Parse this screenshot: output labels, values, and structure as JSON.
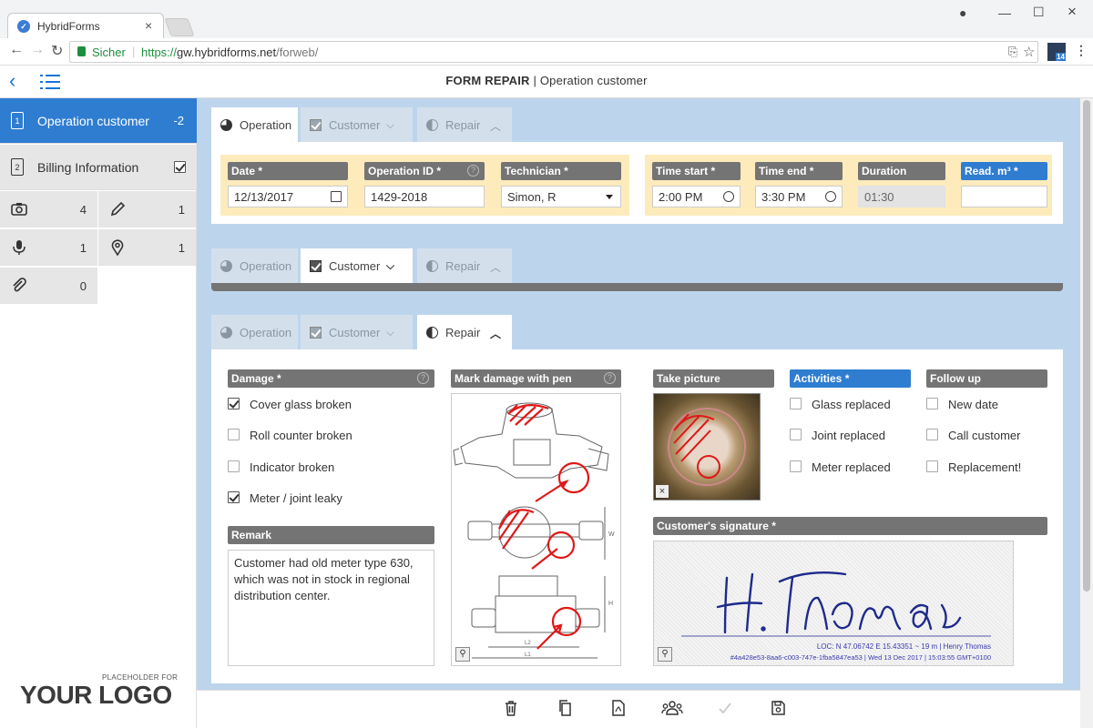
{
  "browser": {
    "tab_title": "HybridForms",
    "secure_label": "Sicher",
    "url_scheme": "https://",
    "url_host": "gw.hybridforms.net",
    "url_path": "/forweb/",
    "ext_badge": "14"
  },
  "header": {
    "title_main": "FORM REPAIR",
    "title_sep": " | ",
    "title_sub": "Operation customer"
  },
  "sidebar": {
    "items": [
      {
        "num": "1",
        "label": "Operation customer",
        "count": "-2"
      },
      {
        "num": "2",
        "label": "Billing Information"
      }
    ],
    "tiles": [
      {
        "icon": "camera-icon",
        "count": "4"
      },
      {
        "icon": "pen-icon",
        "count": "1"
      },
      {
        "icon": "microphone-icon",
        "count": "1"
      },
      {
        "icon": "location-pin-icon",
        "count": "1"
      },
      {
        "icon": "paperclip-icon",
        "count": "0"
      }
    ],
    "logo_placeholder": "PLACEHOLDER FOR",
    "logo_text": "YOUR LOGO"
  },
  "tabs": {
    "operation": "Operation",
    "customer": "Customer",
    "repair": "Repair"
  },
  "operation": {
    "date_label": "Date *",
    "date_value": "12/13/2017",
    "opid_label": "Operation ID *",
    "opid_value": "1429-2018",
    "tech_label": "Technician *",
    "tech_value": "Simon, R",
    "tstart_label": "Time start *",
    "tstart_value": "2:00 PM",
    "tend_label": "Time end *",
    "tend_value": "3:30 PM",
    "duration_label": "Duration",
    "duration_value": "01:30",
    "read_label": "Read. m³ *",
    "read_value": ""
  },
  "repair": {
    "damage_label": "Damage *",
    "damage_options": [
      {
        "label": "Cover glass broken",
        "checked": true
      },
      {
        "label": "Roll counter broken",
        "checked": false
      },
      {
        "label": "Indicator broken",
        "checked": false
      },
      {
        "label": "Meter / joint leaky",
        "checked": true
      }
    ],
    "remark_label": "Remark",
    "remark_text": "Customer had old meter type 630, which was not in stock in regional distribution center.",
    "mark_label": "Mark damage with pen",
    "picture_label": "Take picture",
    "activities_label": "Activities *",
    "activities": [
      {
        "label": "Glass replaced",
        "checked": false
      },
      {
        "label": "Joint replaced",
        "checked": false
      },
      {
        "label": "Meter replaced",
        "checked": false
      }
    ],
    "followup_label": "Follow up",
    "followup": [
      {
        "label": "New date",
        "checked": false
      },
      {
        "label": "Call customer",
        "checked": false
      },
      {
        "label": "Replacement!",
        "checked": false
      }
    ],
    "signature_label": "Customer's signature *",
    "signature_loc": "LOC: N 47.06742   E 15.43351   ~ 19 m  |  Henry Thomas",
    "signature_meta": "#4a428e53-8aa6-c003-747e-1fba5847ea53  |  Wed 13 Dec 2017  |  15:03:55 GMT+0100"
  },
  "footer": {
    "icons": [
      "trash-icon",
      "copy-icon",
      "pdf-icon",
      "users-icon",
      "check-icon",
      "save-icon"
    ]
  },
  "colors": {
    "accent": "#2f7dd1",
    "main_bg": "#bdd5ec",
    "field_group_bg": "#fdebbc",
    "label_bg": "#747474",
    "ink_red": "#e01818",
    "ink_blue": "#1f2a8c"
  }
}
